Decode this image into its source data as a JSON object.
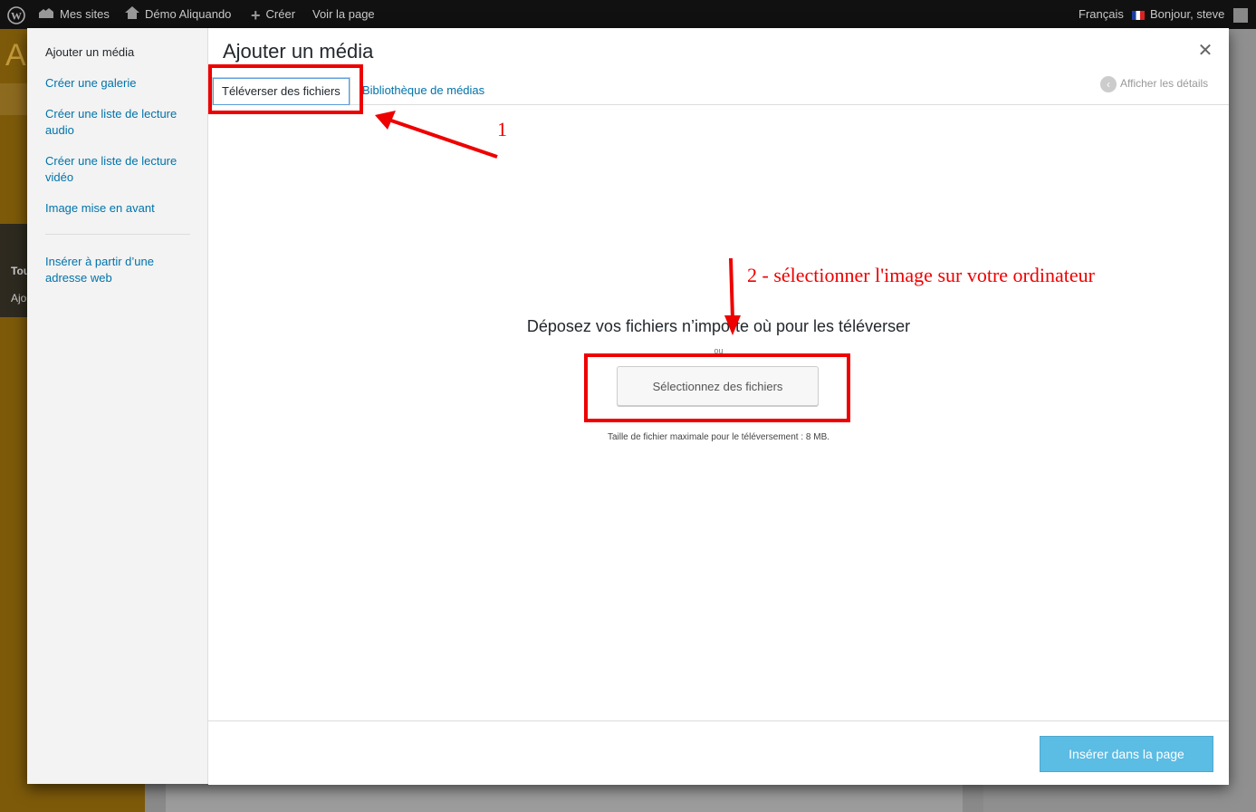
{
  "admin_bar": {
    "wordpress_icon": "wordpress-logo-icon",
    "my_sites": "Mes sites",
    "site_name": "Démo Aliquando",
    "new_content": "Créer",
    "view_page": "Voir la page",
    "language": "Français",
    "greeting": "Bonjour, steve"
  },
  "background": {
    "menu_fragments": [
      "Tou",
      "Ajo"
    ],
    "logo_fragment": "A"
  },
  "media_modal": {
    "title": "Ajouter un média",
    "close_icon": "close-icon",
    "menu": {
      "items": [
        {
          "label": "Ajouter un média",
          "active": true
        },
        {
          "label": "Créer une galerie",
          "active": false
        },
        {
          "label": "Créer une liste de lecture audio",
          "active": false
        },
        {
          "label": "Créer une liste de lecture vidéo",
          "active": false
        },
        {
          "label": "Image mise en avant",
          "active": false
        },
        {
          "label": "Insérer à partir d’une adresse web",
          "active": false
        }
      ]
    },
    "tabs": [
      {
        "label": "Téléverser des fichiers",
        "active": true
      },
      {
        "label": "Bibliothèque de médias",
        "active": false
      }
    ],
    "details_toggle": "Afficher les détails",
    "uploader": {
      "drop_instructions": "Déposez vos fichiers n’importe où pour les téléverser",
      "or": "ou",
      "select_button": "Sélectionnez des fichiers",
      "max_upload_size": "Taille de fichier maximale pour le téléversement : 8 MB."
    },
    "insert_button": "Insérer dans la page"
  },
  "annotations": {
    "step1": "1",
    "step2": "2 - sélectionner l'image sur votre ordinateur",
    "color": "#e00000"
  },
  "colors": {
    "link": "#0073aa",
    "primary_disabled": "#5bbce4",
    "admin_bar": "#111111"
  }
}
